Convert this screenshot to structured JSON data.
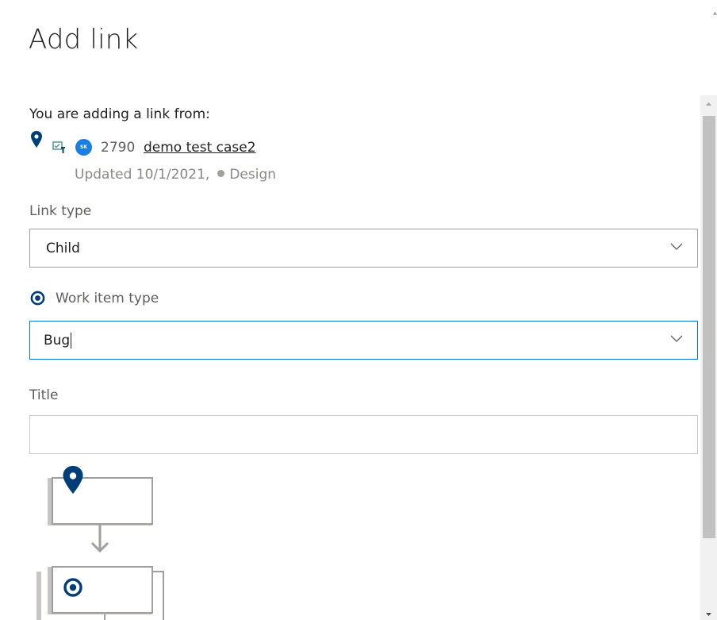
{
  "dialog": {
    "title": "Add link"
  },
  "link_from": {
    "label": "You are adding a link from:",
    "work_item": {
      "id": "2790",
      "title": "demo test case2",
      "avatar_initials": "SK",
      "avatar_color": "#1b7ee6",
      "updated": "Updated 10/1/2021,",
      "state": "Design",
      "icons": [
        "map-pin-icon",
        "test-case-icon"
      ]
    }
  },
  "form": {
    "link_type": {
      "label": "Link type",
      "value": "Child"
    },
    "work_item_type": {
      "label": "Work item type",
      "value": "Bug"
    },
    "title": {
      "label": "Title",
      "value": ""
    }
  },
  "colors": {
    "accent": "#0078d4",
    "diagram_blue": "#003e79"
  }
}
